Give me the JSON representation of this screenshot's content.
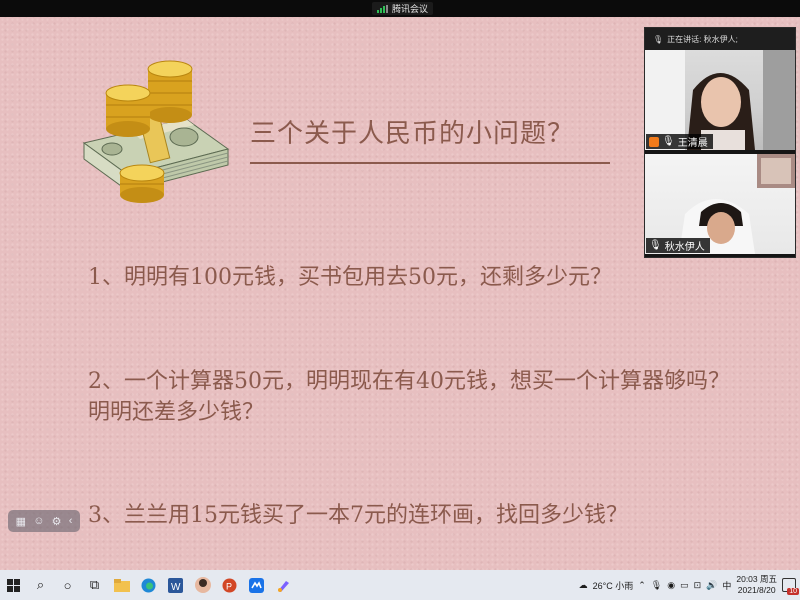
{
  "meeting": {
    "app_name": "腾讯会议",
    "signal_color": "#2fbf56"
  },
  "slide": {
    "title": "三个关于人民币的小问题？",
    "questions": [
      "1、明明有100元钱，买书包用去50元，还剩多少元？",
      "2、一个计算器50元，明明现在有40元钱，想买一个计算器够吗？",
      "明明还差多少钱？",
      "3、兰兰用15元钱买了一本7元的连环画，找回多少钱？"
    ],
    "text_color": "#8b5a4d",
    "background_color": "#e7bfc0"
  },
  "video_panel": {
    "speaking_label": "正在讲话: 秋水伊人;",
    "participants": [
      {
        "name": "王清晨",
        "role": "host"
      },
      {
        "name": "秋水伊人",
        "role": "member"
      }
    ]
  },
  "taskbar": {
    "pinned_icons": [
      "windows-start-icon",
      "search-icon",
      "cortana-icon",
      "task-view-icon",
      "file-explorer-icon",
      "edge-icon",
      "word-icon",
      "user-app-icon",
      "powerpoint-icon",
      "tencent-meeting-icon",
      "paint-icon"
    ],
    "weather": "26°C 小雨",
    "ime": "中",
    "time": "20:03 周五",
    "date": "2021/8/20",
    "notification_count": "10"
  }
}
